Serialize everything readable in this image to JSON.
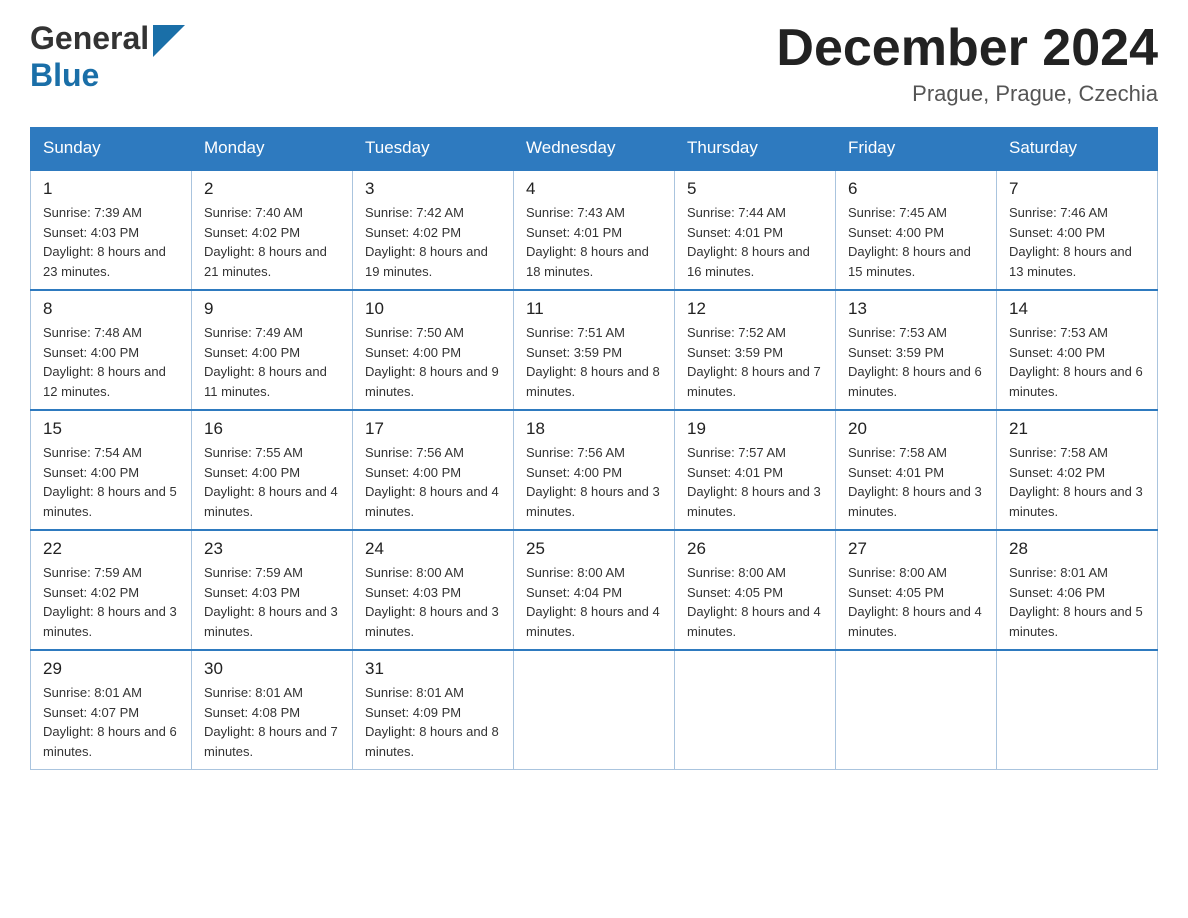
{
  "header": {
    "logo": {
      "general": "General",
      "blue": "Blue",
      "triangle_color": "#1a6fa8"
    },
    "title": "December 2024",
    "location": "Prague, Prague, Czechia"
  },
  "calendar": {
    "weekdays": [
      "Sunday",
      "Monday",
      "Tuesday",
      "Wednesday",
      "Thursday",
      "Friday",
      "Saturday"
    ],
    "weeks": [
      [
        {
          "day": "1",
          "sunrise": "7:39 AM",
          "sunset": "4:03 PM",
          "daylight": "8 hours and 23 minutes."
        },
        {
          "day": "2",
          "sunrise": "7:40 AM",
          "sunset": "4:02 PM",
          "daylight": "8 hours and 21 minutes."
        },
        {
          "day": "3",
          "sunrise": "7:42 AM",
          "sunset": "4:02 PM",
          "daylight": "8 hours and 19 minutes."
        },
        {
          "day": "4",
          "sunrise": "7:43 AM",
          "sunset": "4:01 PM",
          "daylight": "8 hours and 18 minutes."
        },
        {
          "day": "5",
          "sunrise": "7:44 AM",
          "sunset": "4:01 PM",
          "daylight": "8 hours and 16 minutes."
        },
        {
          "day": "6",
          "sunrise": "7:45 AM",
          "sunset": "4:00 PM",
          "daylight": "8 hours and 15 minutes."
        },
        {
          "day": "7",
          "sunrise": "7:46 AM",
          "sunset": "4:00 PM",
          "daylight": "8 hours and 13 minutes."
        }
      ],
      [
        {
          "day": "8",
          "sunrise": "7:48 AM",
          "sunset": "4:00 PM",
          "daylight": "8 hours and 12 minutes."
        },
        {
          "day": "9",
          "sunrise": "7:49 AM",
          "sunset": "4:00 PM",
          "daylight": "8 hours and 11 minutes."
        },
        {
          "day": "10",
          "sunrise": "7:50 AM",
          "sunset": "4:00 PM",
          "daylight": "8 hours and 9 minutes."
        },
        {
          "day": "11",
          "sunrise": "7:51 AM",
          "sunset": "3:59 PM",
          "daylight": "8 hours and 8 minutes."
        },
        {
          "day": "12",
          "sunrise": "7:52 AM",
          "sunset": "3:59 PM",
          "daylight": "8 hours and 7 minutes."
        },
        {
          "day": "13",
          "sunrise": "7:53 AM",
          "sunset": "3:59 PM",
          "daylight": "8 hours and 6 minutes."
        },
        {
          "day": "14",
          "sunrise": "7:53 AM",
          "sunset": "4:00 PM",
          "daylight": "8 hours and 6 minutes."
        }
      ],
      [
        {
          "day": "15",
          "sunrise": "7:54 AM",
          "sunset": "4:00 PM",
          "daylight": "8 hours and 5 minutes."
        },
        {
          "day": "16",
          "sunrise": "7:55 AM",
          "sunset": "4:00 PM",
          "daylight": "8 hours and 4 minutes."
        },
        {
          "day": "17",
          "sunrise": "7:56 AM",
          "sunset": "4:00 PM",
          "daylight": "8 hours and 4 minutes."
        },
        {
          "day": "18",
          "sunrise": "7:56 AM",
          "sunset": "4:00 PM",
          "daylight": "8 hours and 3 minutes."
        },
        {
          "day": "19",
          "sunrise": "7:57 AM",
          "sunset": "4:01 PM",
          "daylight": "8 hours and 3 minutes."
        },
        {
          "day": "20",
          "sunrise": "7:58 AM",
          "sunset": "4:01 PM",
          "daylight": "8 hours and 3 minutes."
        },
        {
          "day": "21",
          "sunrise": "7:58 AM",
          "sunset": "4:02 PM",
          "daylight": "8 hours and 3 minutes."
        }
      ],
      [
        {
          "day": "22",
          "sunrise": "7:59 AM",
          "sunset": "4:02 PM",
          "daylight": "8 hours and 3 minutes."
        },
        {
          "day": "23",
          "sunrise": "7:59 AM",
          "sunset": "4:03 PM",
          "daylight": "8 hours and 3 minutes."
        },
        {
          "day": "24",
          "sunrise": "8:00 AM",
          "sunset": "4:03 PM",
          "daylight": "8 hours and 3 minutes."
        },
        {
          "day": "25",
          "sunrise": "8:00 AM",
          "sunset": "4:04 PM",
          "daylight": "8 hours and 4 minutes."
        },
        {
          "day": "26",
          "sunrise": "8:00 AM",
          "sunset": "4:05 PM",
          "daylight": "8 hours and 4 minutes."
        },
        {
          "day": "27",
          "sunrise": "8:00 AM",
          "sunset": "4:05 PM",
          "daylight": "8 hours and 4 minutes."
        },
        {
          "day": "28",
          "sunrise": "8:01 AM",
          "sunset": "4:06 PM",
          "daylight": "8 hours and 5 minutes."
        }
      ],
      [
        {
          "day": "29",
          "sunrise": "8:01 AM",
          "sunset": "4:07 PM",
          "daylight": "8 hours and 6 minutes."
        },
        {
          "day": "30",
          "sunrise": "8:01 AM",
          "sunset": "4:08 PM",
          "daylight": "8 hours and 7 minutes."
        },
        {
          "day": "31",
          "sunrise": "8:01 AM",
          "sunset": "4:09 PM",
          "daylight": "8 hours and 8 minutes."
        },
        null,
        null,
        null,
        null
      ]
    ]
  }
}
